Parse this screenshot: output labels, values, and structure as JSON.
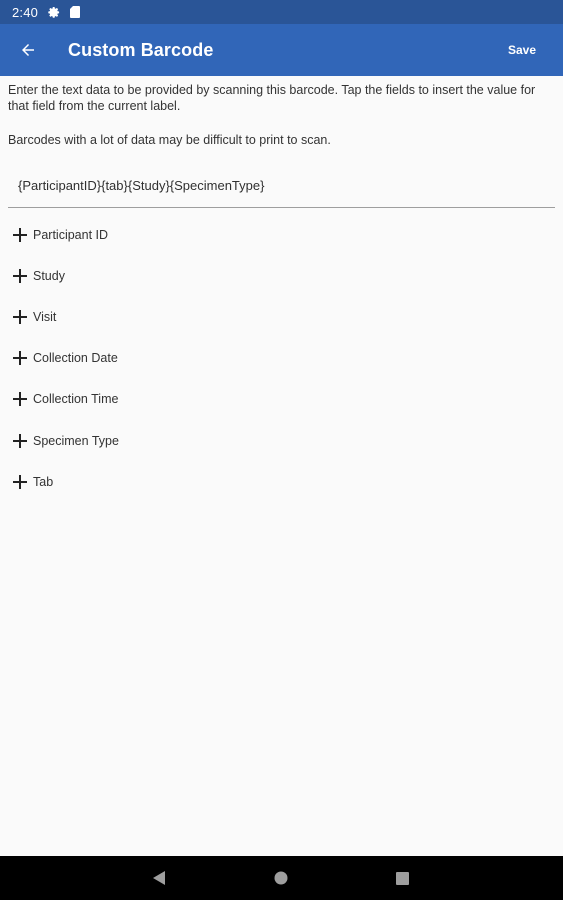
{
  "status_bar": {
    "time": "2:40",
    "icons": [
      "settings-gear-icon",
      "sd-card-icon"
    ]
  },
  "app_bar": {
    "title": "Custom Barcode",
    "back_icon": "arrow-back-icon",
    "save_label": "Save",
    "colors": {
      "status_bar": "#2a5597",
      "app_bar": "#3166b8"
    }
  },
  "content": {
    "intro": "Enter the text data to be provided by scanning this barcode. Tap the fields to insert the value for that field from the current label.",
    "note": "Barcodes with a lot of data may be difficult to print to scan.",
    "barcode_value": "{ParticipantID}{tab}{Study}{SpecimenType}",
    "fields": [
      {
        "label": "Participant ID",
        "icon": "plus-icon"
      },
      {
        "label": "Study",
        "icon": "plus-icon"
      },
      {
        "label": "Visit",
        "icon": "plus-icon"
      },
      {
        "label": "Collection Date",
        "icon": "plus-icon"
      },
      {
        "label": "Collection Time",
        "icon": "plus-icon"
      },
      {
        "label": "Specimen Type",
        "icon": "plus-icon"
      },
      {
        "label": "Tab",
        "icon": "plus-icon"
      }
    ]
  },
  "nav_bar": {
    "buttons": [
      "back-triangle-icon",
      "home-circle-icon",
      "recents-square-icon"
    ]
  }
}
